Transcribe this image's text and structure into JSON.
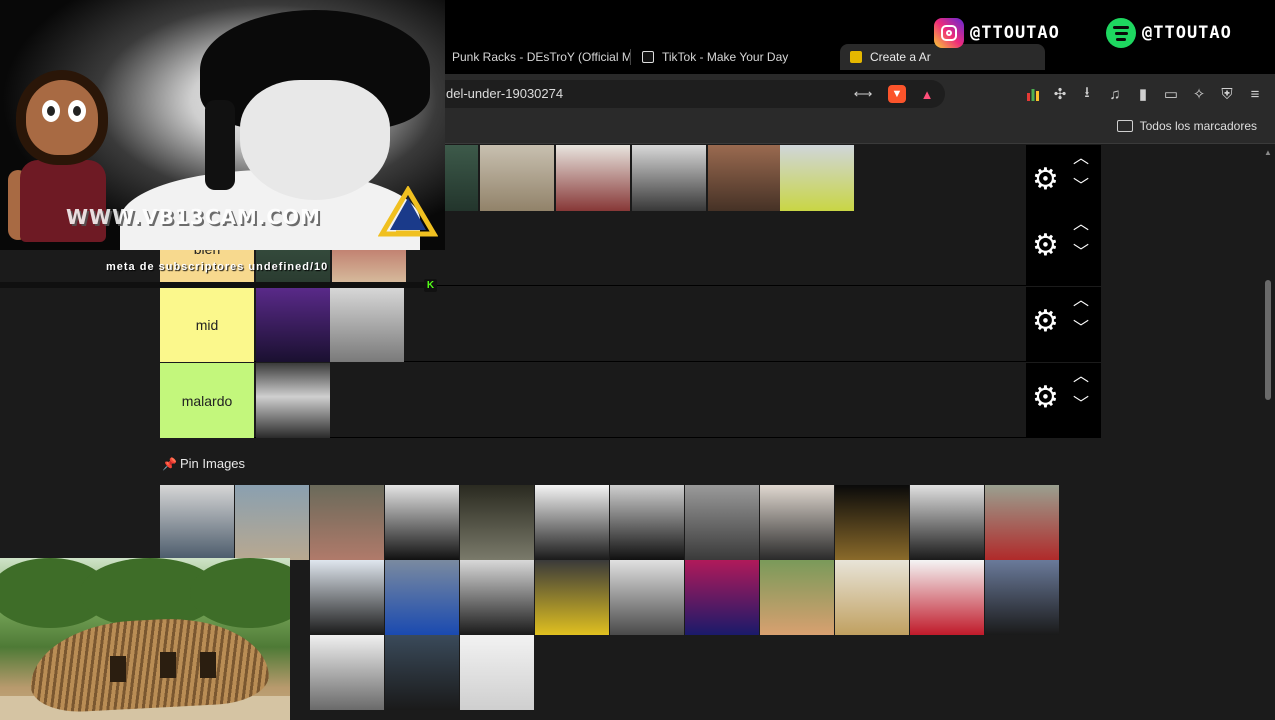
{
  "browser": {
    "tabs": [
      {
        "title": "Punk Racks - DEsTroY (Official M",
        "favicon_color": "#e53935"
      },
      {
        "title": "TikTok - Make Your Day",
        "favicon_color": "#111111"
      },
      {
        "title": "Create a Ar",
        "favicon_color": "#e6b800",
        "active": true
      }
    ],
    "url": "del-under-19030274",
    "bookmarks_label": "Todos los marcadores"
  },
  "social": {
    "instagram_handle": "@TTOUTAO",
    "spotify_handle": "@TTOUTAO"
  },
  "stream": {
    "watermark": "WWW.VB13CAM.COM",
    "meta_text": "meta de subscriptores undefined/10"
  },
  "tiers": [
    {
      "label": "",
      "color": "#1a1a1a"
    },
    {
      "label": "bien",
      "color": "#f7d98e"
    },
    {
      "label": "mid",
      "color": "#fbf88c"
    },
    {
      "label": "malardo",
      "color": "#c3f77c"
    }
  ],
  "pin_images_label": "Pin Images",
  "colors": {
    "accent_black": "#000000",
    "tier_bg": "#1a1a1a",
    "page_bg": "#1b1b1b"
  }
}
